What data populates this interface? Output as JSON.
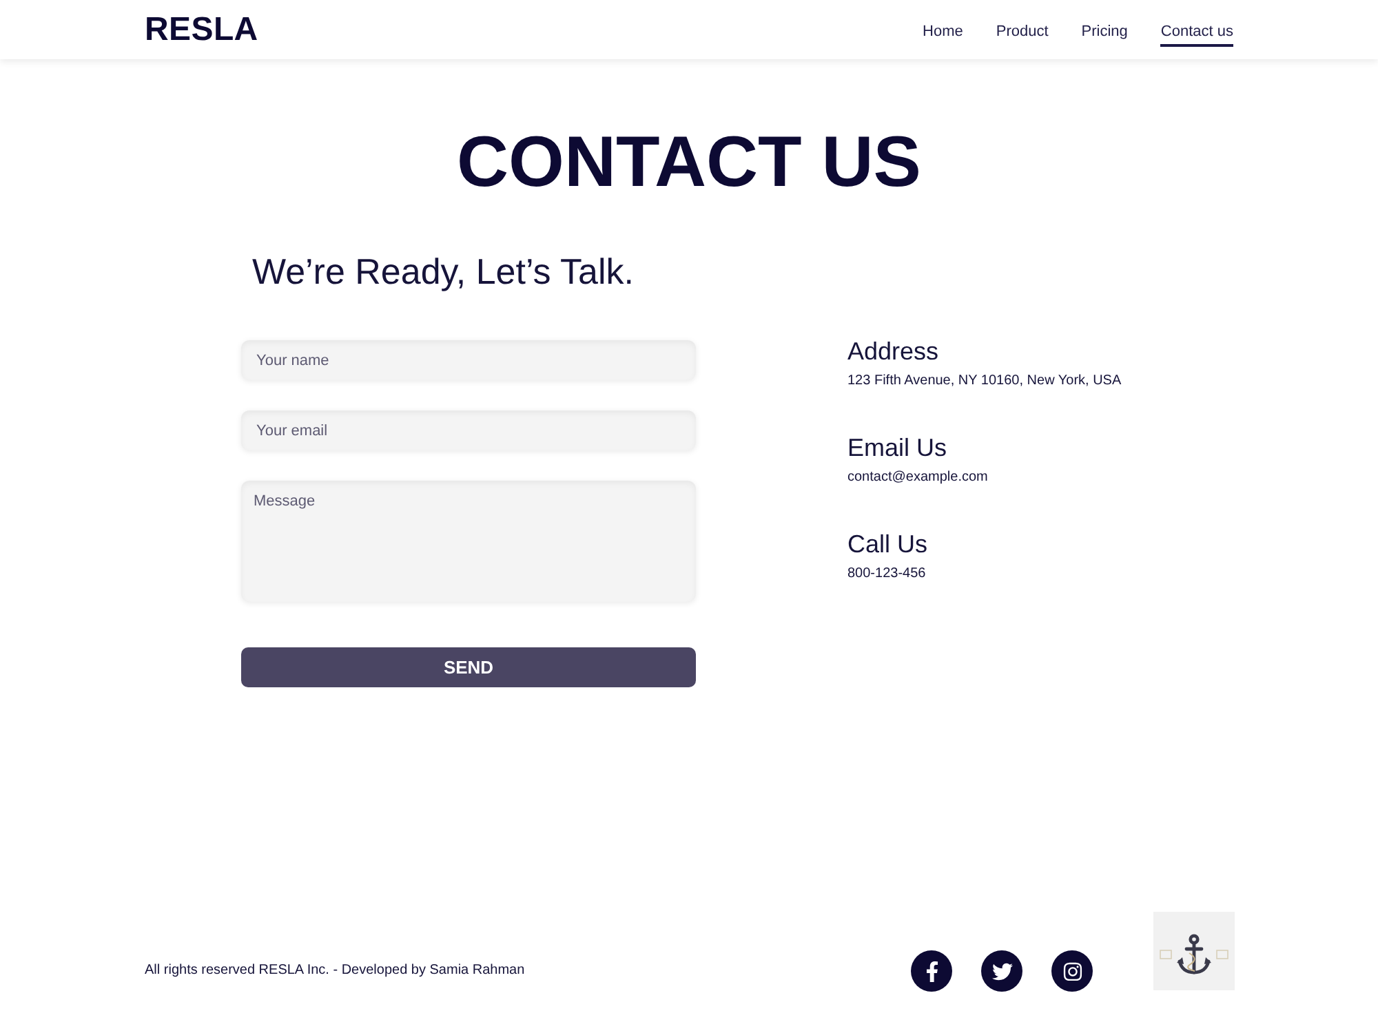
{
  "header": {
    "logo": "RESLA",
    "nav": [
      {
        "label": "Home",
        "selected": false
      },
      {
        "label": "Product",
        "selected": false
      },
      {
        "label": "Pricing",
        "selected": false
      },
      {
        "label": "Contact us",
        "selected": true
      }
    ]
  },
  "page_title": "CONTACT US",
  "tagline": "We’re Ready, Let’s Talk.",
  "form": {
    "fields": [
      {
        "kind": "input",
        "placeholder": "Your name"
      },
      {
        "kind": "input",
        "placeholder": "Your email"
      },
      {
        "kind": "textarea",
        "placeholder": "Message"
      }
    ],
    "submit": "SEND"
  },
  "contact_info": [
    {
      "heading": "Address",
      "text": "123 Fifth Avenue, NY 10160, New York, USA"
    },
    {
      "heading": "Email Us",
      "text": "contact@example.com"
    },
    {
      "heading": "Call Us",
      "text": "800-123-456"
    }
  ],
  "footer": {
    "copyright": "All rights reserved RESLA Inc. - Developed by Samia Rahman",
    "social_links": [
      {
        "kind": "facebook"
      },
      {
        "kind": "twitter"
      },
      {
        "kind": "instagram"
      }
    ]
  }
}
